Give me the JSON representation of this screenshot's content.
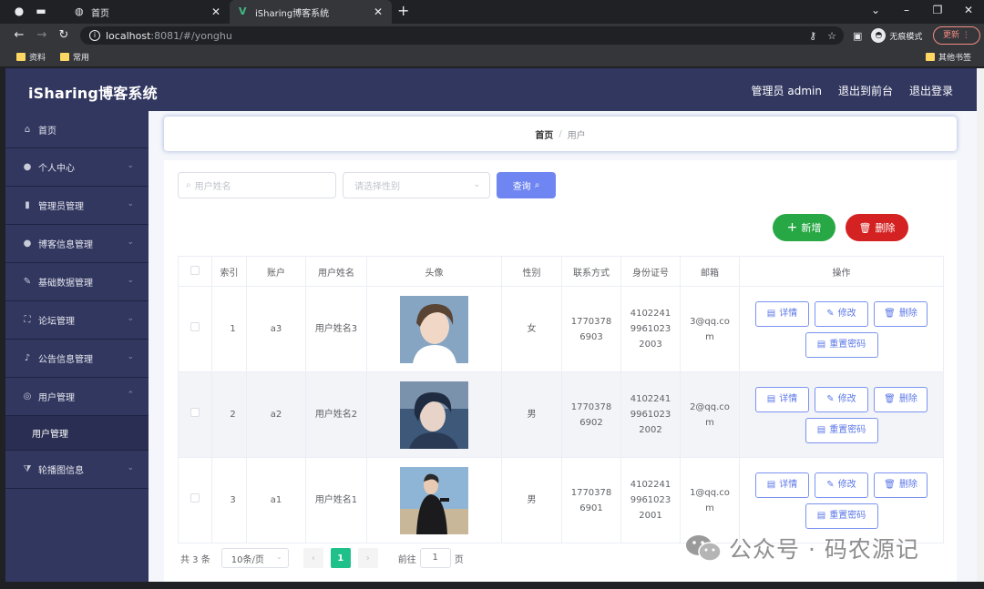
{
  "browser": {
    "tabs": [
      {
        "label": "首页",
        "active": false
      },
      {
        "label": "iSharing博客系统",
        "active": true
      }
    ],
    "address": {
      "host": "localhost",
      "rest": ":8081/#/yonghu"
    },
    "incognito_label": "无痕模式",
    "update_label": "更新",
    "bookmarks": [
      "资料",
      "常用"
    ],
    "other_bookmarks": "其他书签"
  },
  "header": {
    "brand": "iSharing博客系统",
    "links": [
      "管理员 admin",
      "退出到前台",
      "退出登录"
    ]
  },
  "sidebar": {
    "items": [
      {
        "label": "首页",
        "icon": "home-icon"
      },
      {
        "label": "个人中心",
        "icon": "user-icon"
      },
      {
        "label": "管理员管理",
        "icon": "chart-icon"
      },
      {
        "label": "博客信息管理",
        "icon": "user-icon"
      },
      {
        "label": "基础数据管理",
        "icon": "pen-icon"
      },
      {
        "label": "论坛管理",
        "icon": "fullscreen-icon"
      },
      {
        "label": "公告信息管理",
        "icon": "microphone-icon"
      },
      {
        "label": "用户管理",
        "icon": "compass-icon",
        "expanded": true
      },
      {
        "label": "轮播图信息",
        "icon": "tag-icon"
      }
    ],
    "submenu": {
      "label": "用户管理"
    }
  },
  "breadcrumb": {
    "home": "首页",
    "separator": "/",
    "current": "用户"
  },
  "search": {
    "name_placeholder": "用户姓名",
    "gender_placeholder": "请选择性别",
    "query_label": "查询"
  },
  "actions": {
    "add_label": "新增",
    "delete_label": "删除"
  },
  "table": {
    "columns": [
      "索引",
      "账户",
      "用户姓名",
      "头像",
      "性别",
      "联系方式",
      "身份证号",
      "邮箱",
      "操作"
    ],
    "rows": [
      {
        "index": "1",
        "account": "a3",
        "name": "用户姓名3",
        "gender": "女",
        "phone": "17703786903",
        "id_card": "410224199610232003",
        "email": "3@qq.com"
      },
      {
        "index": "2",
        "account": "a2",
        "name": "用户姓名2",
        "gender": "男",
        "phone": "17703786902",
        "id_card": "410224199610232002",
        "email": "2@qq.com"
      },
      {
        "index": "3",
        "account": "a1",
        "name": "用户姓名1",
        "gender": "男",
        "phone": "17703786901",
        "id_card": "410224199610232001",
        "email": "1@qq.com"
      }
    ],
    "row_actions": {
      "detail": "详情",
      "edit": "修改",
      "delete": "删除",
      "reset": "重置密码"
    }
  },
  "pagination": {
    "total": "共 3 条",
    "page_size": "10条/页",
    "current_page": "1",
    "goto_prefix": "前往",
    "goto_value": "1",
    "goto_suffix": "页"
  },
  "watermark": "公众号 · 码农源记",
  "colors": {
    "sidebar_bg": "#323760",
    "primary": "#6f86f2",
    "add_green": "#27a844",
    "delete_red": "#d42121",
    "page_active": "#20c08a"
  }
}
